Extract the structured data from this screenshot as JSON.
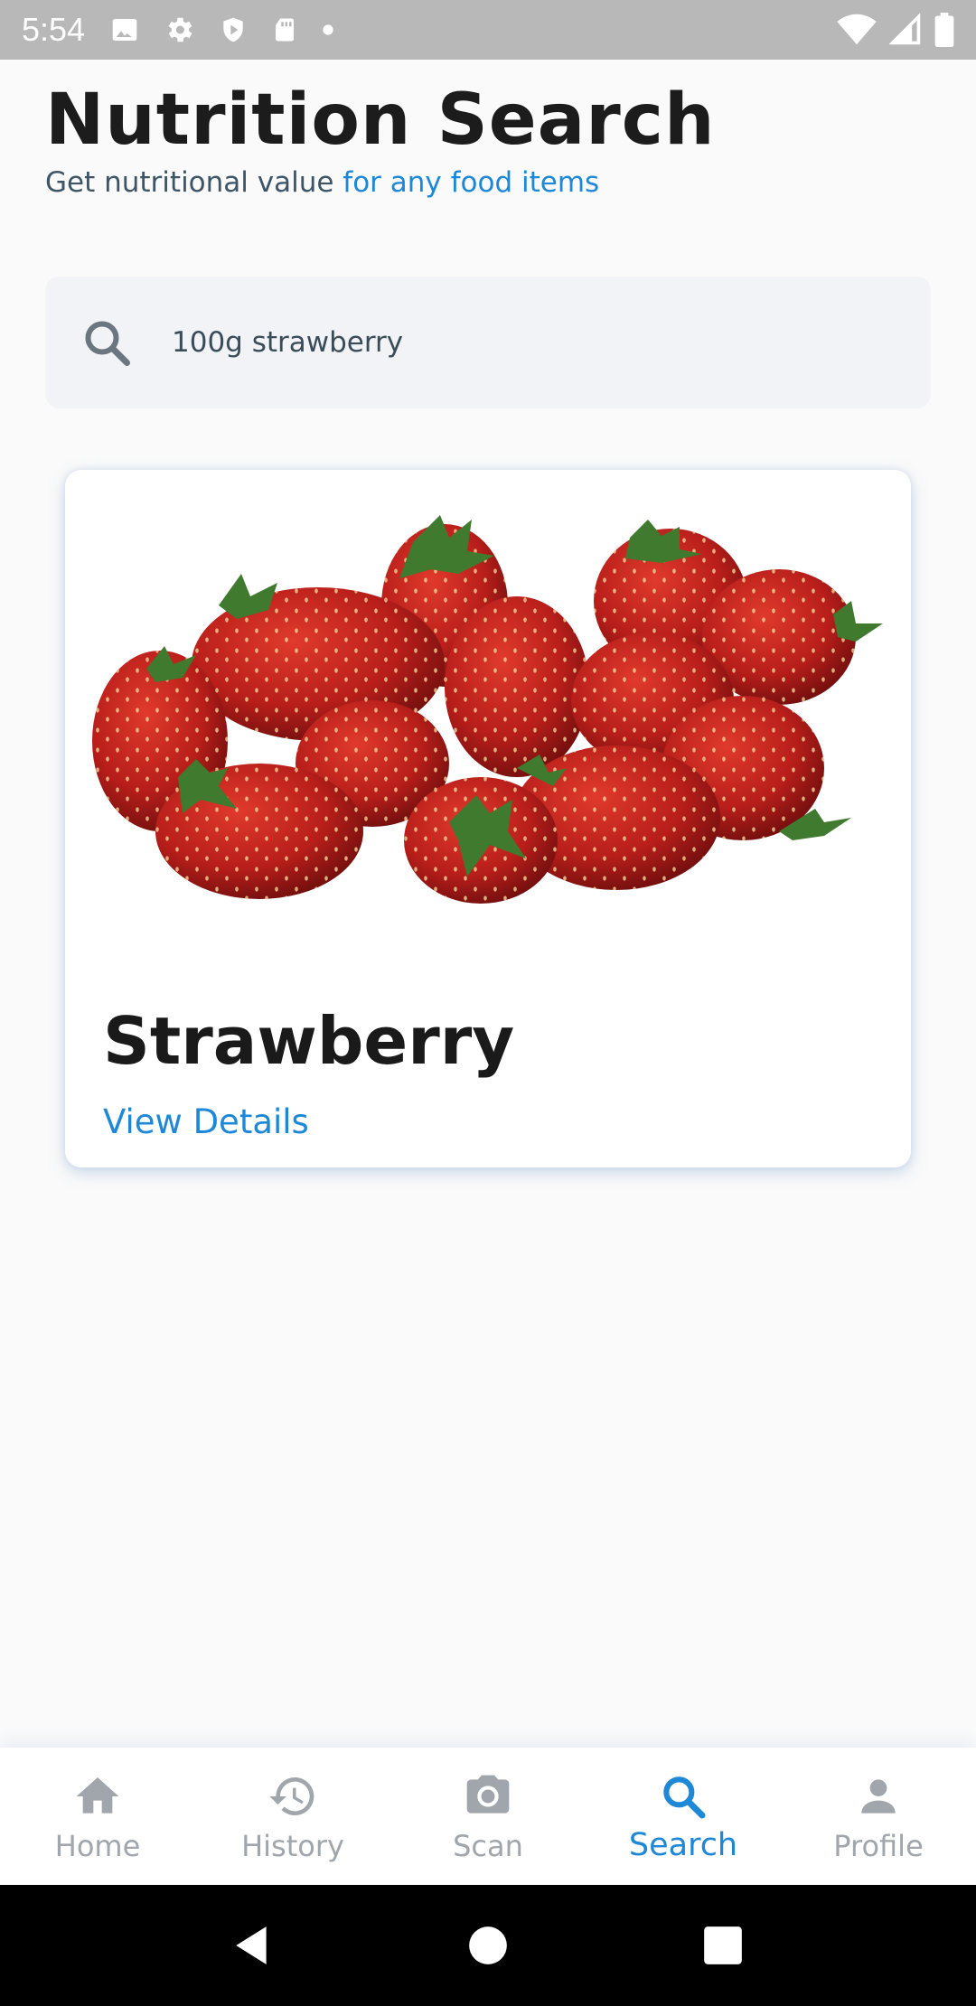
{
  "status_bar": {
    "time": "5:54",
    "icons_left": [
      "image-icon",
      "settings-icon",
      "shield-icon",
      "sd-card-icon",
      "dot-icon"
    ],
    "icons_right": [
      "wifi-icon",
      "signal-icon",
      "battery-icon"
    ]
  },
  "header": {
    "title": "Nutrition Search",
    "subtitle_plain": "Get nutritional value ",
    "subtitle_accent": "for any food items"
  },
  "search": {
    "value": "100g strawberry",
    "icon": "search-icon"
  },
  "result": {
    "name": "Strawberry",
    "action": "View Details",
    "image": "strawberries-image"
  },
  "bottom_nav": {
    "items": [
      {
        "label": "Home",
        "icon": "home-icon"
      },
      {
        "label": "History",
        "icon": "history-icon"
      },
      {
        "label": "Scan",
        "icon": "camera-icon"
      },
      {
        "label": "Search",
        "icon": "search-icon",
        "active": true
      },
      {
        "label": "Profile",
        "icon": "person-icon"
      }
    ]
  },
  "colors": {
    "accent": "#1e88d8",
    "inactive": "#a0a6ab",
    "status_bar": "#b8b8b8"
  }
}
